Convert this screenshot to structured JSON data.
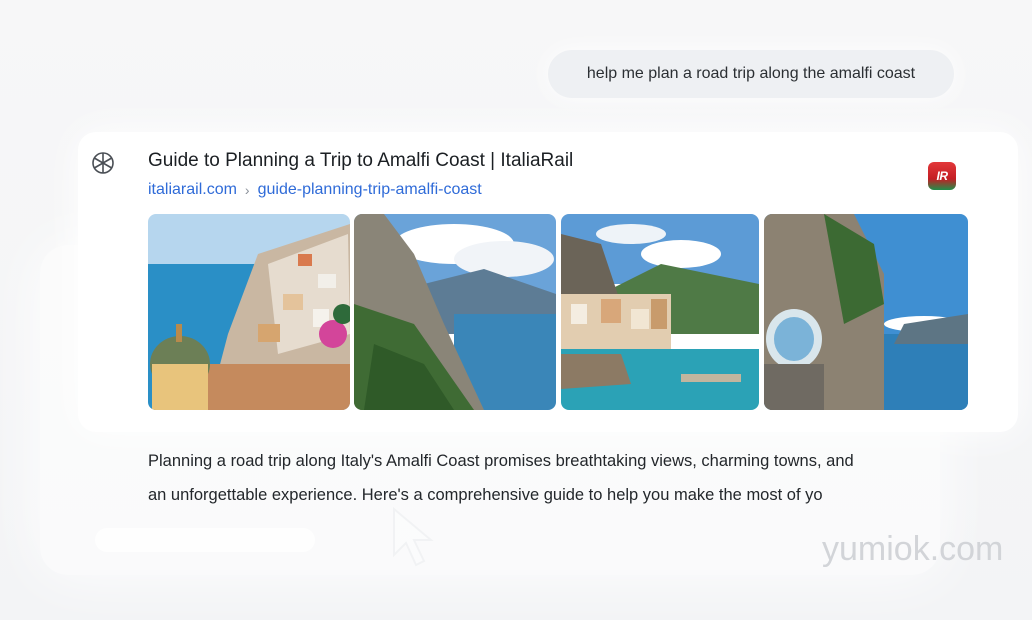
{
  "conversation": {
    "user_message": "help me plan a road trip along the amalfi coast"
  },
  "search_result": {
    "title": "Guide to Planning a Trip to Amalfi Coast | ItaliaRail",
    "domain": "italiarail.com",
    "separator": "›",
    "path": "guide-planning-trip-amalfi-coast",
    "site_badge": "IR",
    "images": [
      {
        "icon": "positano-photo"
      },
      {
        "icon": "cliff-coast-photo"
      },
      {
        "icon": "harbor-village-photo"
      },
      {
        "icon": "rock-tunnel-photo"
      }
    ]
  },
  "answer": {
    "line1": "Planning a road trip along Italy's Amalfi Coast promises breathtaking views, charming towns, and",
    "line2": "an unforgettable experience. Here's a comprehensive guide to help you make the most of yo"
  },
  "watermark": "yumiok.com",
  "colors": {
    "link": "#2f6bd8",
    "badge_red": "#d32a2f",
    "badge_green": "#1f8f4a"
  }
}
